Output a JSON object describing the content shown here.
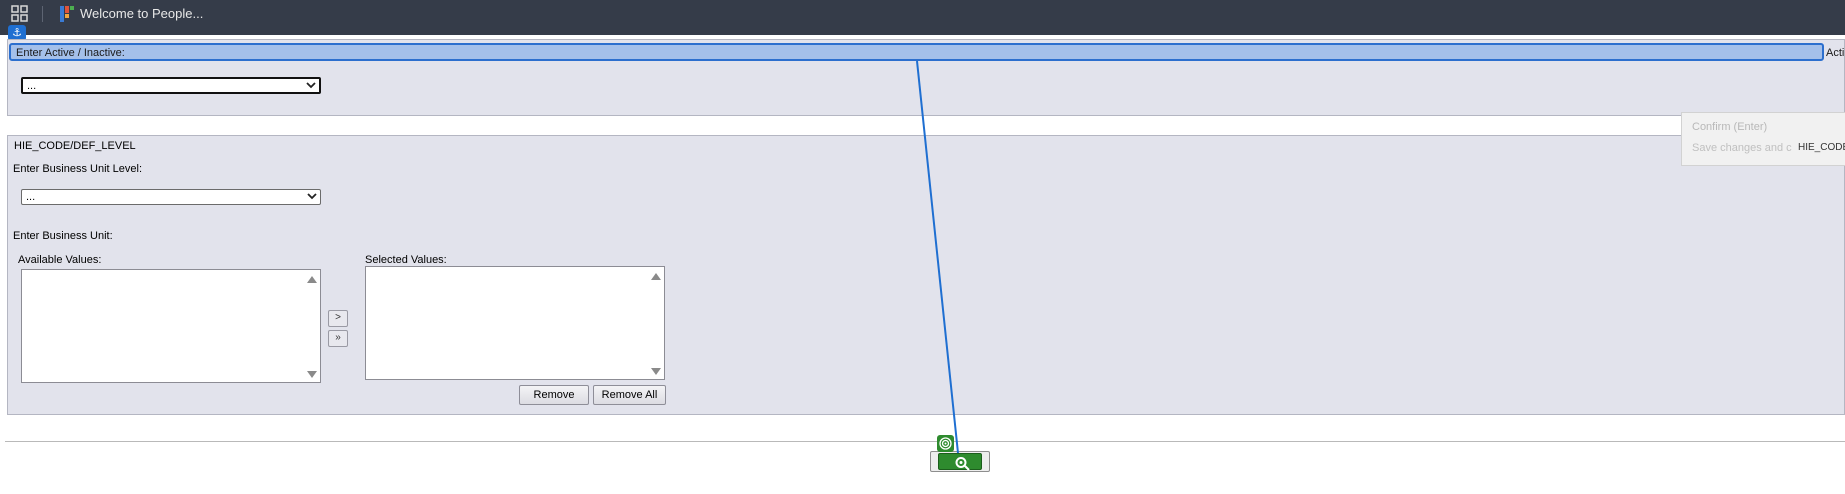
{
  "topbar": {
    "app_title": "Welcome to People..."
  },
  "active_section": {
    "header_label": "Enter Active / Inactive:",
    "header_right_label": "Acti",
    "select_value": "..."
  },
  "hie_section": {
    "title": "HIE_CODE/DEF_LEVEL",
    "bu_level_label": "Enter Business Unit Level:",
    "bu_level_value": "...",
    "bu_label": "Enter Business Unit:",
    "available_label": "Available Values:",
    "selected_label": "Selected Values:",
    "add_label": ">",
    "add_all_label": "»",
    "remove_label": "Remove",
    "remove_all_label": "Remove All"
  },
  "tooltip": {
    "title": "Confirm (Enter)",
    "description": "Save changes and c",
    "overlap_text": "HIE_CODE"
  },
  "colors": {
    "topbar_bg": "#353c49",
    "highlight_border": "#2c6fce",
    "highlight_fill": "#a4c0ea",
    "confirm_green": "#2e8b2e"
  },
  "icons": [
    "apps-grid-icon",
    "app-logo-icon",
    "anchor-icon",
    "chevron-down-icon",
    "target-icon",
    "confirm-gear-icon"
  ]
}
